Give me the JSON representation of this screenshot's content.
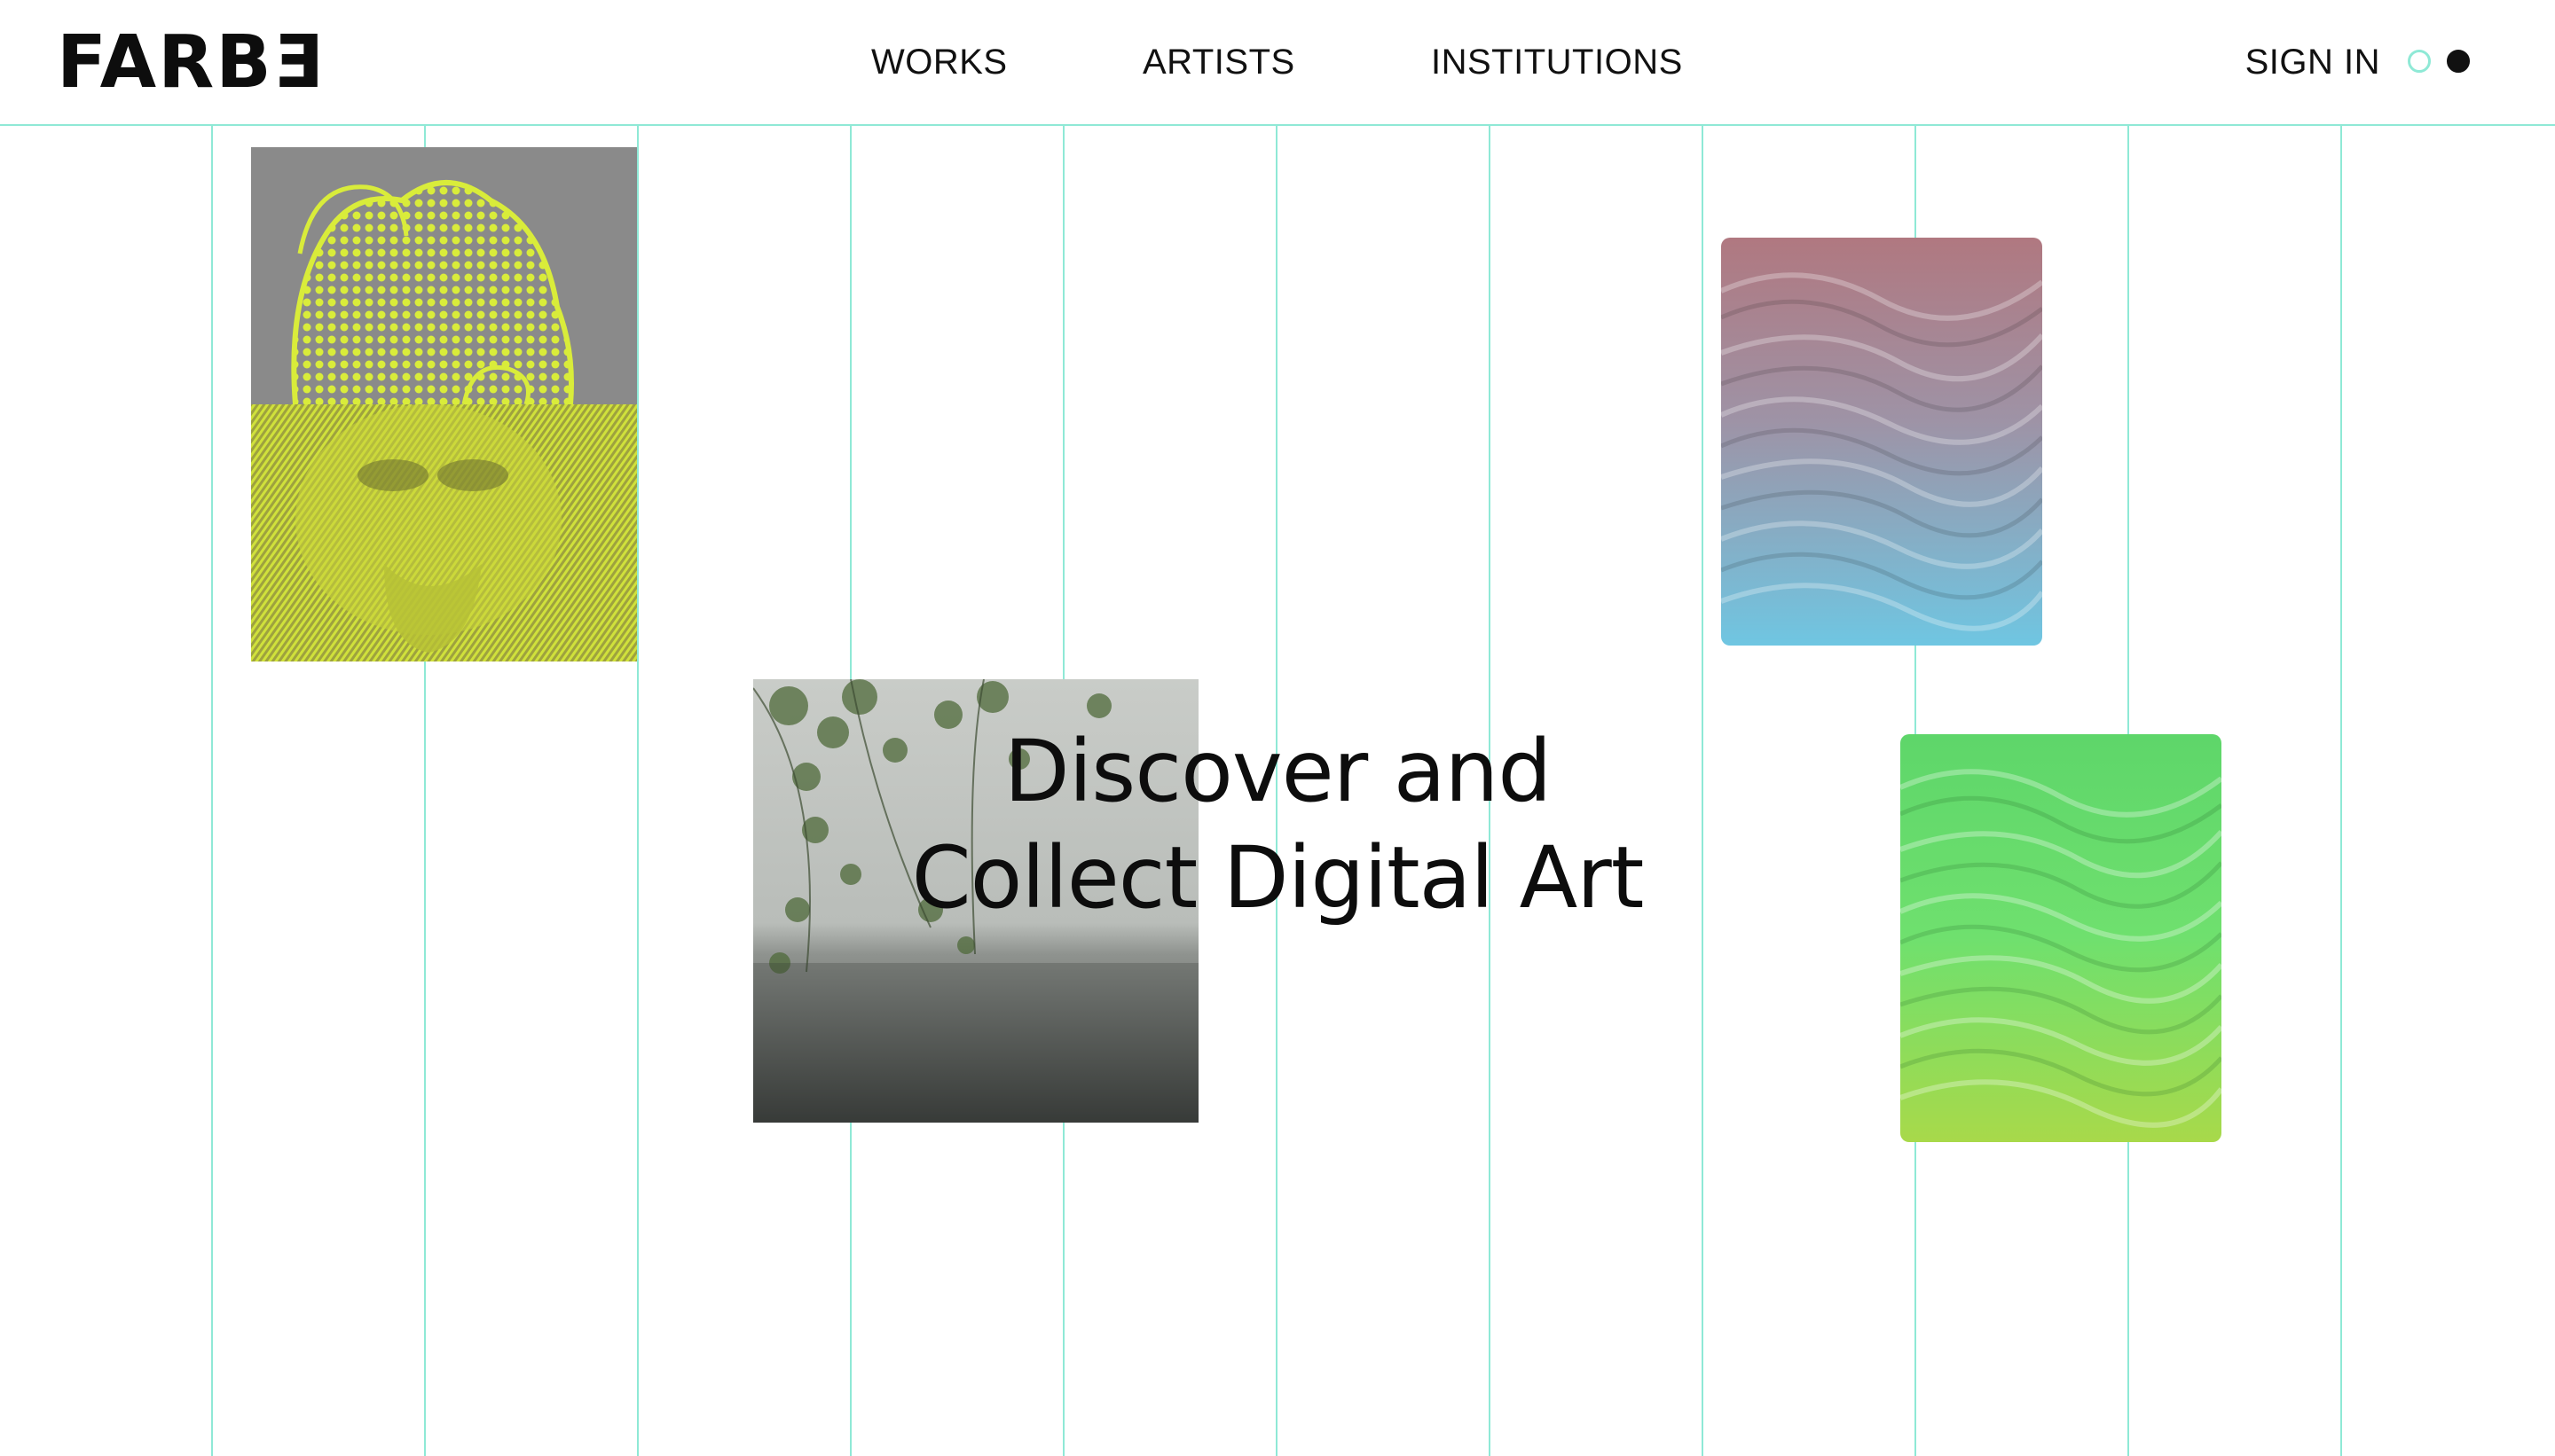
{
  "brand": {
    "logo_text": "FARBƎ"
  },
  "nav": {
    "items": [
      {
        "label": "WORKS"
      },
      {
        "label": "ARTISTS"
      },
      {
        "label": "INSTITUTIONS"
      }
    ],
    "sign_in_label": "SIGN IN",
    "theme_toggle": {
      "light": "theme-light",
      "dark": "theme-dark"
    }
  },
  "hero": {
    "line1": "Discover and",
    "line2": "Collect Digital Art"
  },
  "colors": {
    "grid_line": "#8fe9d6",
    "text": "#111111",
    "neon_yellow": "#d9ec3a",
    "sculpture_bg": "#8a8a8a"
  }
}
